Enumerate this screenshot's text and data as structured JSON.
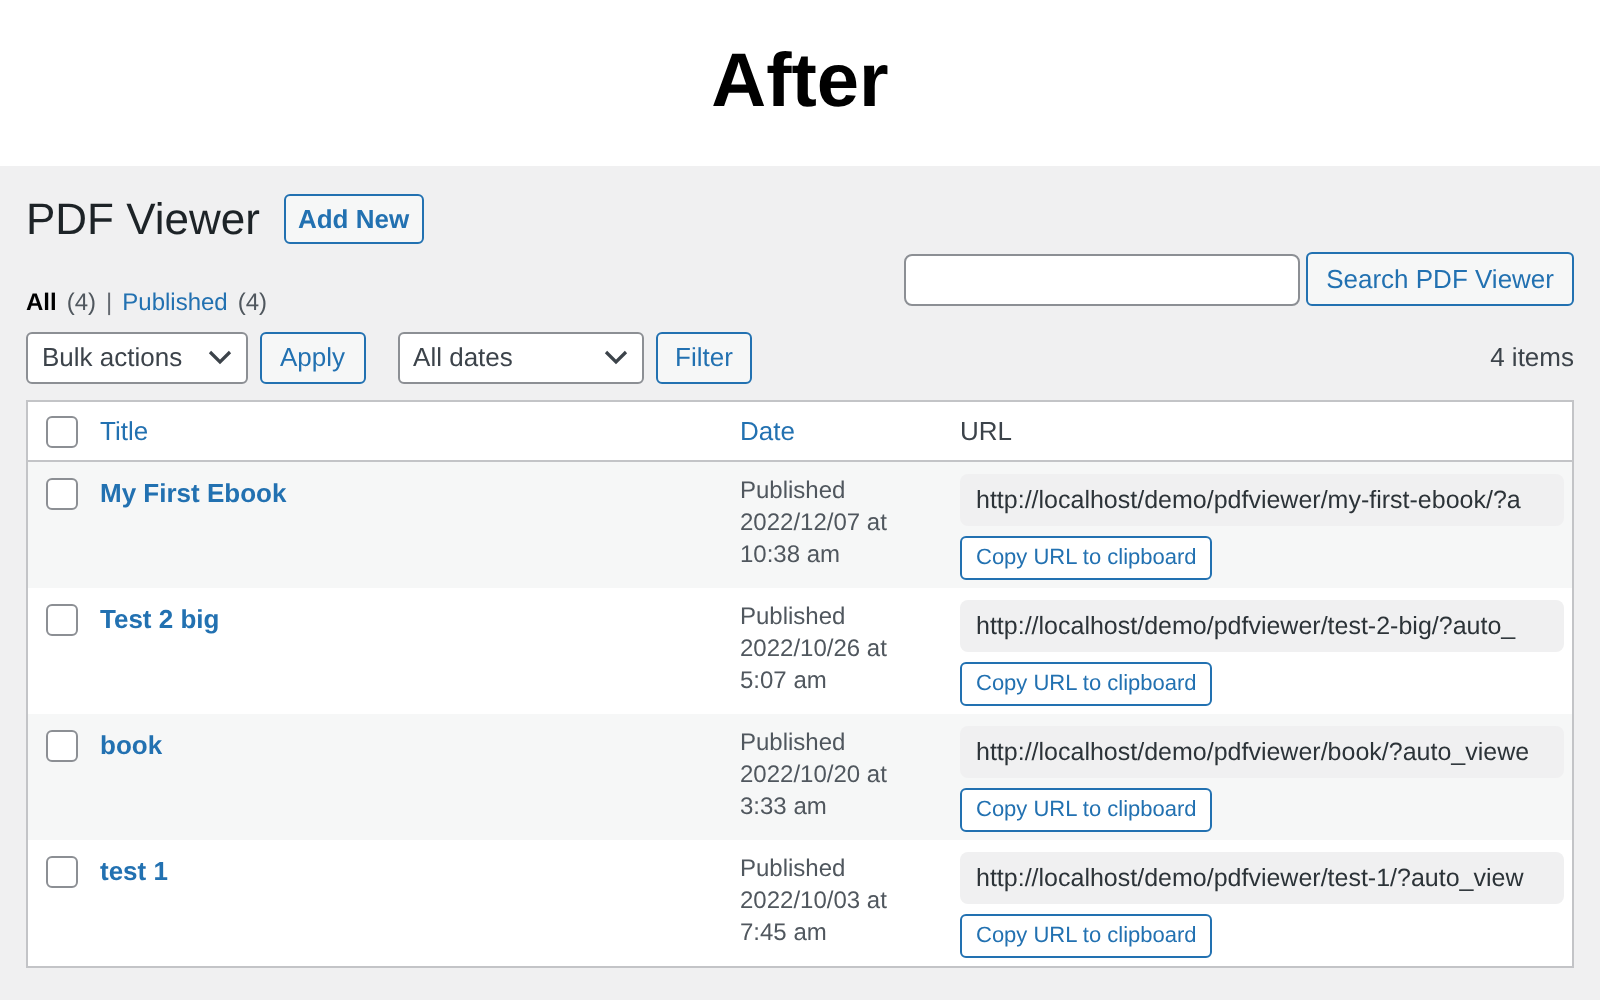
{
  "banner": {
    "title": "After"
  },
  "page": {
    "title": "PDF Viewer",
    "add_button": "Add New"
  },
  "filters": [
    {
      "label": "All",
      "count": "(4)",
      "selected": true
    },
    {
      "label": "Published",
      "count": "(4)",
      "selected": false
    }
  ],
  "filter_separator": "|",
  "search": {
    "button": "Search PDF Viewer"
  },
  "bulk": {
    "value": "Bulk actions",
    "button": "Apply"
  },
  "dates": {
    "value": "All dates",
    "button": "Filter"
  },
  "item_count": "4 items",
  "table": {
    "select_all_checked": false,
    "columns": [
      "Title",
      "Date",
      "URL"
    ],
    "rows": [
      {
        "title": "My First Ebook",
        "status": "Published",
        "date": "2022/12/07 at",
        "time": "10:38 am",
        "url": "http://localhost/demo/pdfviewer/my-first-ebook/?a",
        "copy": "Copy URL to clipboard",
        "checked": false
      },
      {
        "title": "Test 2 big",
        "status": "Published",
        "date": "2022/10/26 at",
        "time": "5:07 am",
        "url": "http://localhost/demo/pdfviewer/test-2-big/?auto_",
        "copy": "Copy URL to clipboard",
        "checked": false
      },
      {
        "title": "book",
        "status": "Published",
        "date": "2022/10/20 at",
        "time": "3:33 am",
        "url": "http://localhost/demo/pdfviewer/book/?auto_viewe",
        "copy": "Copy URL to clipboard",
        "checked": false
      },
      {
        "title": "test 1",
        "status": "Published",
        "date": "2022/10/03 at",
        "time": "7:45 am",
        "url": "http://localhost/demo/pdfviewer/test-1/?auto_view",
        "copy": "Copy URL to clipboard",
        "checked": false
      }
    ]
  }
}
